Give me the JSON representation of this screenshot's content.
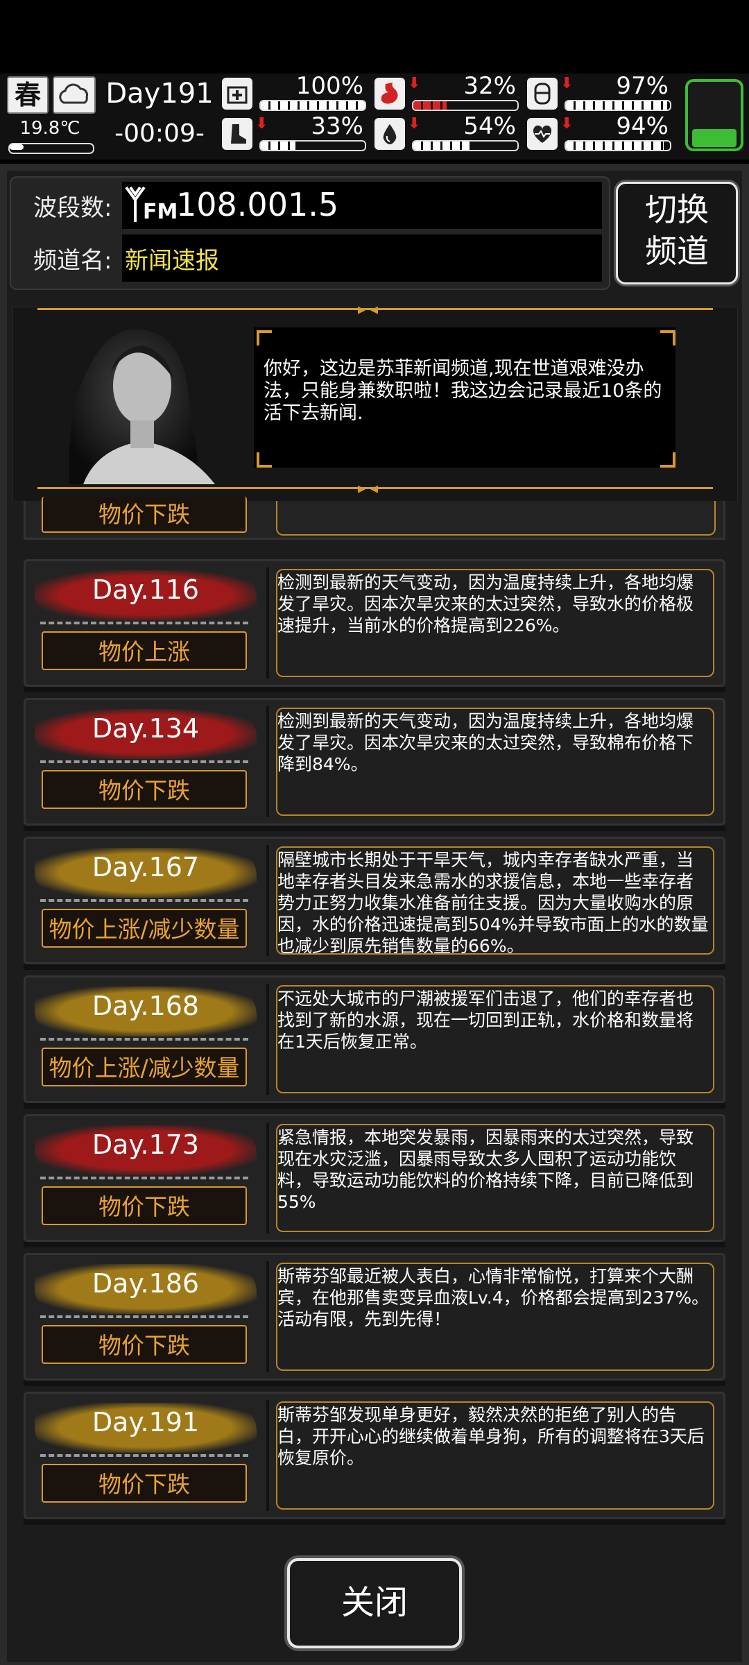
{
  "status": {
    "season": "春",
    "temperature": "19.8℃",
    "temperature_level": 0.12,
    "day": "Day191",
    "time": "-00:09-",
    "stats": [
      {
        "name": "health-icon",
        "value": "100%",
        "level": 1.0,
        "arrow": false,
        "color": "#ffffff"
      },
      {
        "name": "stomach-icon",
        "value": "32%",
        "level": 0.32,
        "arrow": true,
        "color": "#d22222"
      },
      {
        "name": "mood-icon",
        "value": "97%",
        "level": 0.97,
        "arrow": true,
        "color": "#ffffff"
      },
      {
        "name": "stamina-icon",
        "value": "33%",
        "level": 0.33,
        "arrow": true,
        "color": "#ffffff"
      },
      {
        "name": "water-icon",
        "value": "54%",
        "level": 0.54,
        "arrow": true,
        "color": "#ffffff"
      },
      {
        "name": "heart-icon",
        "value": "94%",
        "level": 0.94,
        "arrow": true,
        "color": "#ffffff"
      }
    ],
    "battery_color": "#3dbd33"
  },
  "radio": {
    "band_label": "波段数:",
    "fm_icon": "FM",
    "frequency": "108.001.5",
    "channel_label": "频道名:",
    "channel_name": "新闻速报",
    "switch_label": "切换频道"
  },
  "announcer": {
    "message": "你好，这边是苏菲新闻频道,现在世道艰难没办法，只能身兼数职啦！我这边会记录最近10条的活下去新闻."
  },
  "partial_item": {
    "tag": "物价下跌"
  },
  "news": [
    {
      "day": "Day.116",
      "tag": "物价上涨",
      "brush": "#9e1a1a",
      "text": "检测到最新的天气变动，因为温度持续上升，各地均爆发了旱灾。因本次旱灾来的太过突然，导致水的价格极速提升，当前水的价格提高到226%。"
    },
    {
      "day": "Day.134",
      "tag": "物价下跌",
      "brush": "#9e1a1a",
      "text": "检测到最新的天气变动，因为温度持续上升，各地均爆发了旱灾。因本次旱灾来的太过突然，导致棉布价格下降到84%。"
    },
    {
      "day": "Day.167",
      "tag": "物价上涨/减少数量",
      "brush": "#a07a18",
      "text": "隔壁城市长期处于干旱天气，城内幸存者缺水严重，当地幸存者头目发来急需水的求援信息，本地一些幸存者势力正努力收集水准备前往支援。因为大量收购水的原因，水的价格迅速提高到504%并导致市面上的水的数量也减少到原先销售数量的66%。"
    },
    {
      "day": "Day.168",
      "tag": "物价上涨/减少数量",
      "brush": "#a07a18",
      "text": "不远处大城市的尸潮被援军们击退了，他们的幸存者也找到了新的水源，现在一切回到正轨，水价格和数量将在1天后恢复正常。"
    },
    {
      "day": "Day.173",
      "tag": "物价下跌",
      "brush": "#9e1a1a",
      "text": "紧急情报，本地突发暴雨，因暴雨来的太过突然，导致现在水灾泛滥，因暴雨导致太多人囤积了运动功能饮料，导致运动功能饮料的价格持续下降，目前已降低到55%"
    },
    {
      "day": "Day.186",
      "tag": "物价下跌",
      "brush": "#a07a18",
      "text": "斯蒂芬邹最近被人表白，心情非常愉悦，打算来个大酬宾，在他那售卖变异血液Lv.4，价格都会提高到237%。活动有限，先到先得！"
    },
    {
      "day": "Day.191",
      "tag": "物价下跌",
      "brush": "#a07a18",
      "text": "斯蒂芬邹发现单身更好，毅然决然的拒绝了别人的告白，开开心心的继续做着单身狗，所有的调整将在3天后恢复原价。"
    }
  ],
  "close_label": "关闭"
}
